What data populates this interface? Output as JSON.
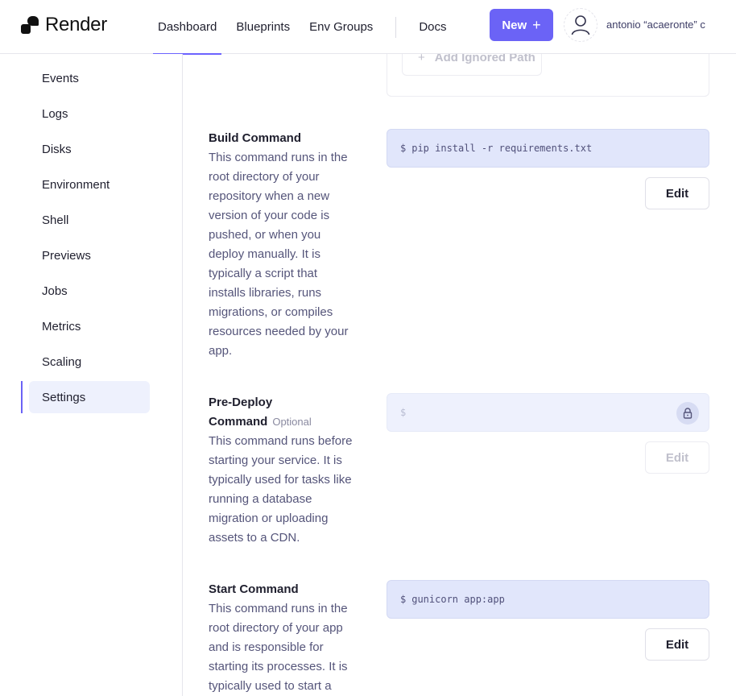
{
  "brand": {
    "name": "Render"
  },
  "nav": {
    "items": [
      "Dashboard",
      "Blueprints",
      "Env Groups"
    ],
    "docs": "Docs",
    "active": "Dashboard"
  },
  "header": {
    "new_label": "New",
    "new_icon": "plus-icon",
    "user_name": "antonio “acaeronte” c",
    "accent_color": "#6b63f6"
  },
  "sidebar": {
    "items": [
      "Events",
      "Logs",
      "Disks",
      "Environment",
      "Shell",
      "Previews",
      "Jobs",
      "Metrics",
      "Scaling",
      "Settings"
    ],
    "active": "Settings"
  },
  "settings": {
    "ignored_paths": {
      "add_label": "Add Ignored Path"
    },
    "build": {
      "title": "Build Command",
      "description": "This command runs in the root directory of your repository when a new version of your code is pushed, or when you deploy manually. It is typically a script that installs libraries, runs migrations, or compiles resources needed by your app.",
      "prefix": "$",
      "value": "pip install -r requirements.txt",
      "edit_label": "Edit"
    },
    "predeploy": {
      "title_line1": "Pre-Deploy",
      "title_line2": "Command",
      "optional_label": "Optional",
      "description": "This command runs before starting your service. It is typically used for tasks like running a database migration or uploading assets to a CDN.",
      "prefix": "$",
      "value": "",
      "locked": true,
      "edit_label": "Edit"
    },
    "start": {
      "title": "Start Command",
      "description": "This command runs in the root directory of your app and is responsible for starting its processes. It is typically used to start a",
      "prefix": "$",
      "value": "gunicorn app:app",
      "edit_label": "Edit"
    }
  }
}
